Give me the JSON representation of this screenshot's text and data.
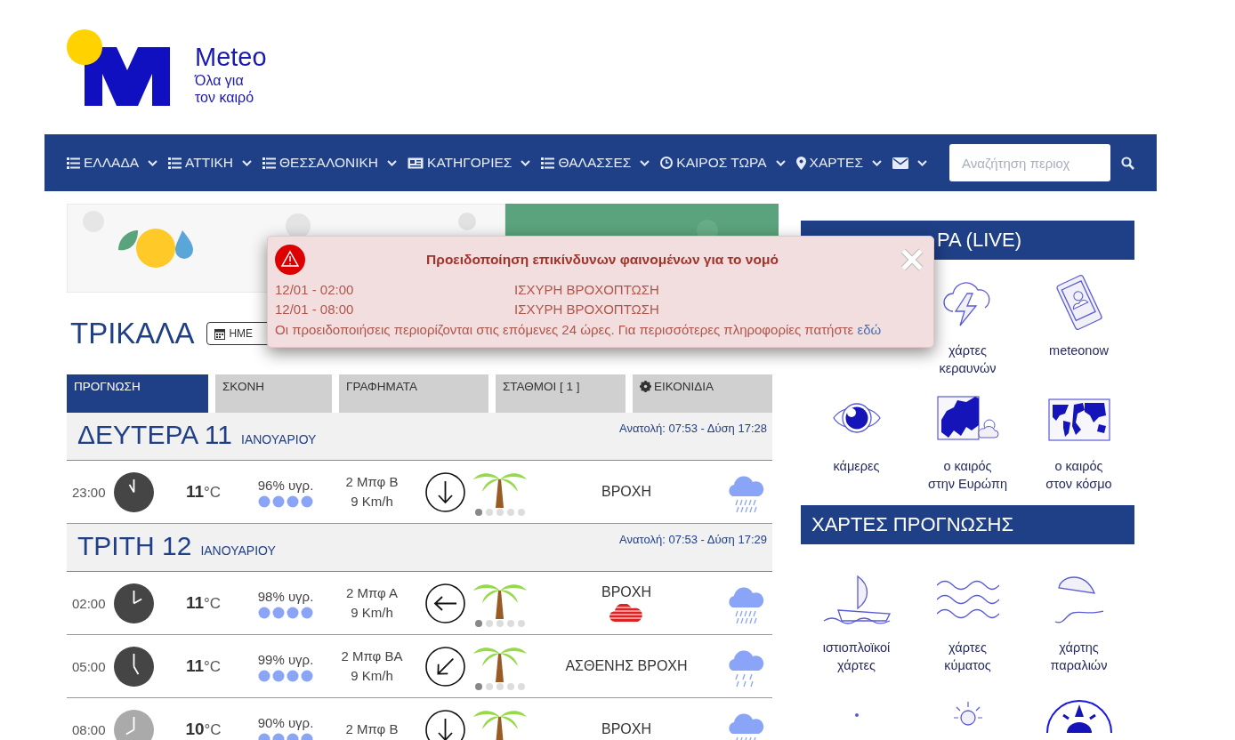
{
  "logo": {
    "name": "Meteo",
    "tagline_1": "Όλα για",
    "tagline_2": "τον καιρό"
  },
  "nav": {
    "items": [
      {
        "kind": "list",
        "label": "ΕΛΛΑΔΑ"
      },
      {
        "kind": "list",
        "label": "ΑΤΤΙΚΗ"
      },
      {
        "kind": "list",
        "label": "ΘΕΣΣΑΛΟΝΙΚΗ"
      },
      {
        "kind": "newspaper",
        "label": "ΚΑΤΗΓΟΡΙΕΣ"
      },
      {
        "kind": "list",
        "label": "ΘΑΛΑΣΣΕΣ"
      },
      {
        "kind": "clock",
        "label": "ΚΑΙΡΟΣ ΤΩΡΑ"
      },
      {
        "kind": "pin",
        "label": "ΧΑΡΤΕΣ"
      },
      {
        "kind": "mail"
      }
    ],
    "search": {
      "placeholder": "Αναζήτηση περιοχ"
    }
  },
  "city": "ΤΡΙΚΑΛΑ",
  "date_button": {
    "label": "ΗΜΕ"
  },
  "tabs": [
    {
      "label": "ΠΡΟΓΝΩΣΗ",
      "selected": true
    },
    {
      "label": "ΣΚΟΝΗ",
      "selected": false
    },
    {
      "label": "ΓΡΑΦΗΜΑΤΑ",
      "selected": false
    },
    {
      "label": "ΣΤΑΘΜΟΙ [ 1 ]",
      "selected": false
    },
    {
      "label": "ΕΙΚΟΝΙΔΙΑ",
      "selected": false,
      "kind": "gear"
    }
  ],
  "days": [
    {
      "weekday": "ΔΕΥΤΕΡΑ 11",
      "month": "ΙΑΝΟΥΑΡΙΟΥ",
      "sun": "Ανατολή: 07:53 - Δύση 17:28",
      "rows": [
        {
          "time": "23:00",
          "daylight": false,
          "temp": "11",
          "unit": "°C",
          "humidity": "96% υγρ.",
          "wind": "2 Μπφ Β",
          "speed": "9 Km/h",
          "wind_arrow": {
            "kind": "down"
          },
          "condition": "ΒΡΟΧΗ",
          "warning": false,
          "kind": "heavy-rain"
        }
      ]
    },
    {
      "weekday": "ΤΡΙΤΗ 12",
      "month": "ΙΑΝΟΥΑΡΙΟΥ",
      "sun": "Ανατολή: 07:53 - Δύση 17:29",
      "rows": [
        {
          "time": "02:00",
          "daylight": false,
          "temp": "11",
          "unit": "°C",
          "humidity": "98% υγρ.",
          "wind": "2 Μπφ Α",
          "speed": "9 Km/h",
          "wind_arrow": {
            "kind": "left"
          },
          "condition": "ΒΡΟΧΗ",
          "warning": true,
          "kind": "heavy-rain"
        },
        {
          "time": "05:00",
          "daylight": false,
          "temp": "11",
          "unit": "°C",
          "humidity": "99% υγρ.",
          "wind": "2 Μπφ ΒΑ",
          "speed": "9 Km/h",
          "wind_arrow": {
            "kind": "down-left"
          },
          "condition": "ΑΣΘΕΝΗΣ ΒΡΟΧΗ",
          "warning": false,
          "kind": "light-rain"
        },
        {
          "time": "08:00",
          "daylight": true,
          "temp": "10",
          "unit": "°C",
          "humidity": "90% υγρ.",
          "wind": "2 Μπφ Β",
          "wind_arrow": {
            "kind": "down"
          },
          "condition": "ΒΡΟΧΗ",
          "warning": false,
          "kind": "heavy-rain"
        }
      ]
    }
  ],
  "sidebar": [
    {
      "title": "ΡΑ (LIVE)",
      "items": [
        {
          "kind": "covered"
        },
        {
          "kind": "lightning",
          "label_1": "χάρτες",
          "label_2": "κεραυνών"
        },
        {
          "kind": "tablet",
          "label_1": "meteonow"
        },
        {
          "kind": "eye",
          "label_1": "κάμερες"
        },
        {
          "kind": "europe",
          "label_1": "ο καιρός",
          "label_2": "στην Ευρώπη"
        },
        {
          "kind": "world",
          "label_1": "ο καιρός",
          "label_2": "στον κόσμο"
        }
      ]
    },
    {
      "title": "ΧΑΡΤΕΣ ΠΡΟΓΝΩΣΗΣ",
      "items": [
        {
          "kind": "sailboat",
          "label_1": "ιστιοπλοϊκοί",
          "label_2": "χάρτες"
        },
        {
          "kind": "waves",
          "label_1": "χάρτες",
          "label_2": "κύματος"
        },
        {
          "kind": "umbrella",
          "label_1": "χάρτης",
          "label_2": "παραλιών"
        },
        {
          "kind": "dot"
        },
        {
          "kind": "sun"
        },
        {
          "kind": "compass"
        }
      ]
    }
  ],
  "alert": {
    "title": "Προειδοποίηση επικίνδυνων φαινομένων για το νομό",
    "entries": [
      {
        "time": "12/01 - 02:00",
        "phenomenon": "ΙΣΧΥΡΗ ΒΡΟΧΟΠΤΩΣΗ"
      },
      {
        "time": "12/01 - 08:00",
        "phenomenon": "ΙΣΧΥΡΗ ΒΡΟΧΟΠΤΩΣΗ"
      }
    ],
    "note": "Οι προειδοποιήσεις περιορίζονται στις επόμενες 24 ώρες. Για περισσότερες πληροφορίες πατήστε",
    "link": "εδώ"
  }
}
